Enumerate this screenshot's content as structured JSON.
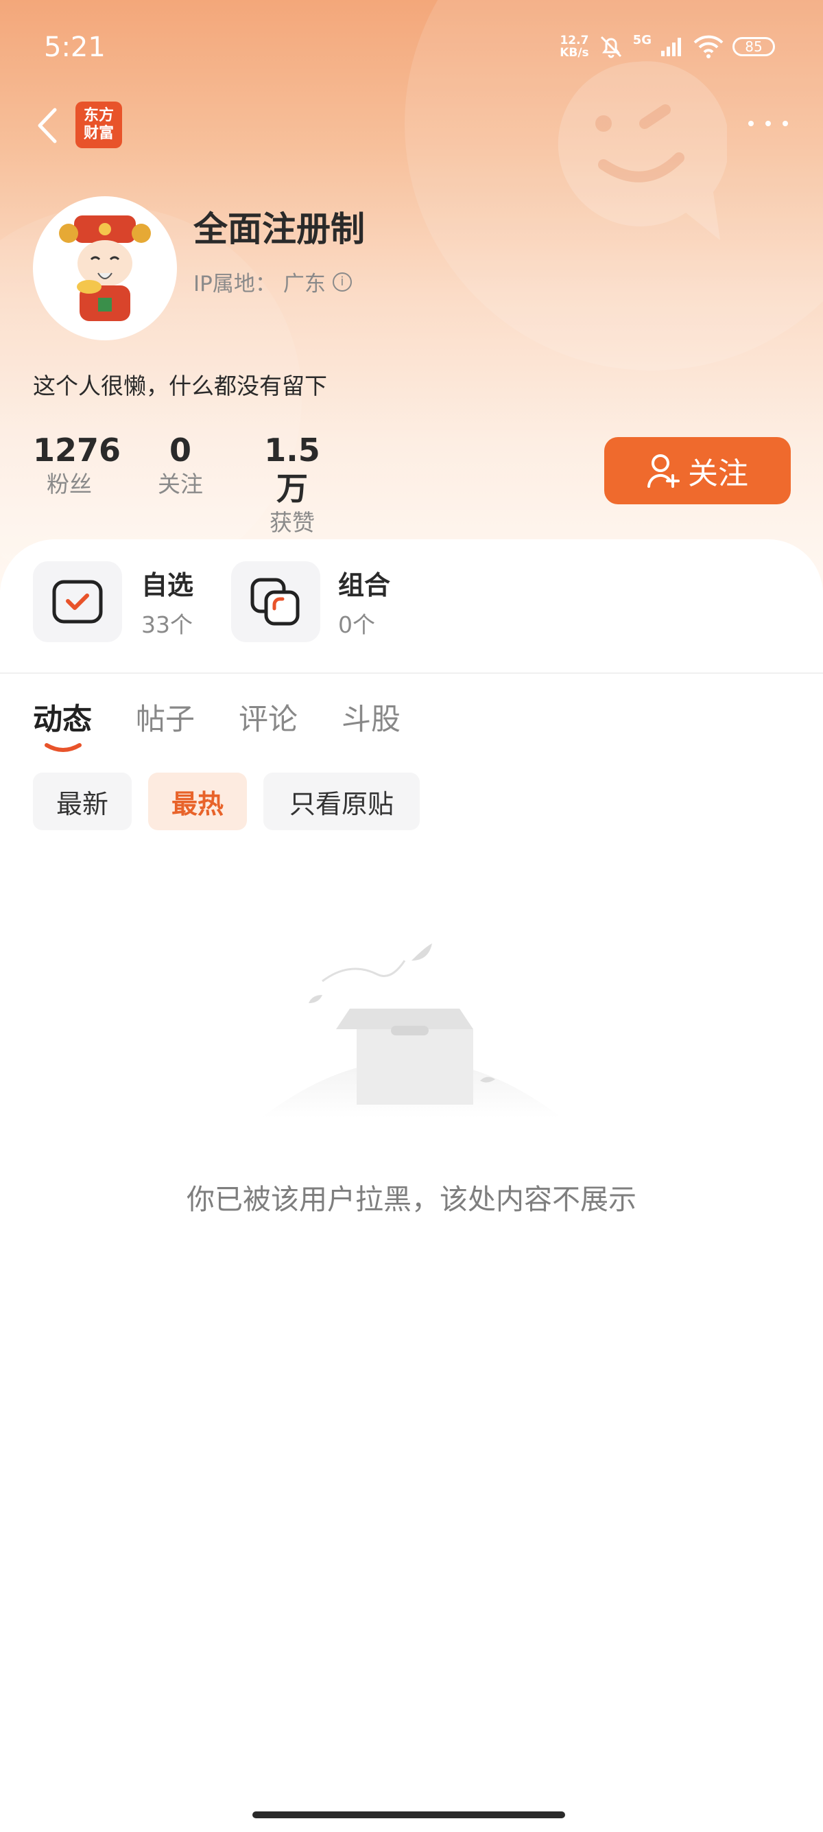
{
  "status_bar": {
    "time": "5:21",
    "net_speed_value": "12.7",
    "net_speed_unit": "KB/s",
    "signal_type": "5G",
    "battery": "85",
    "icons": [
      "bell-off-icon",
      "signal-icon",
      "wifi-icon",
      "battery-icon"
    ]
  },
  "header": {
    "logo_line1": "东方",
    "logo_line2": "财富",
    "logo_color": "#e8532a"
  },
  "profile": {
    "username": "全面注册制",
    "ip_label": "IP属地：",
    "ip_value": "广东",
    "bio": "这个人很懒，什么都没有留下",
    "stats": [
      {
        "value": "1276",
        "label": "粉丝"
      },
      {
        "value": "0",
        "label": "关注"
      },
      {
        "value": "1.5万",
        "label": "获赞"
      }
    ],
    "follow_label": "关注",
    "accent_color": "#ef6a2d"
  },
  "cards": [
    {
      "title": "自选",
      "sub": "33个",
      "icon": "watchlist-icon"
    },
    {
      "title": "组合",
      "sub": "0个",
      "icon": "portfolio-icon"
    }
  ],
  "tabs": [
    "动态",
    "帖子",
    "评论",
    "斗股"
  ],
  "active_tab": "动态",
  "filters": [
    "最新",
    "最热",
    "只看原贴"
  ],
  "active_filter": "最热",
  "empty_state": {
    "message": "你已被该用户拉黑，该处内容不展示",
    "icon": "empty-box-icon"
  }
}
